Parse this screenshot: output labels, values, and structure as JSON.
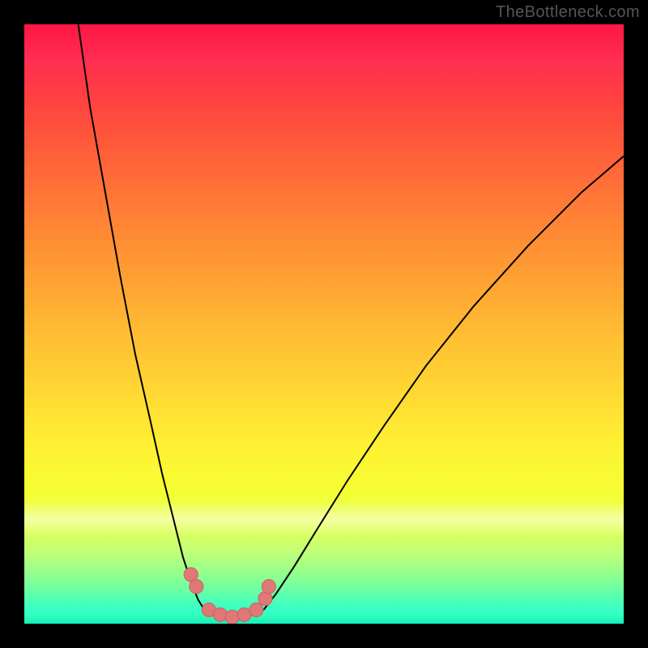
{
  "watermark": "TheBottleneck.com",
  "colors": {
    "curve_stroke": "#000000",
    "marker_fill": "#e07878",
    "marker_stroke": "#d06060"
  },
  "chart_data": {
    "type": "line",
    "title": "",
    "xlabel": "",
    "ylabel": "",
    "xlim": [
      0,
      100
    ],
    "ylim": [
      0,
      100
    ],
    "note": "Axes have no tick labels; values are approximate positions in percent of plot area (0,0 = top-left).",
    "series": [
      {
        "name": "left-arm",
        "x": [
          9.0,
          11.0,
          13.5,
          16.0,
          18.5,
          21.0,
          23.0,
          25.0,
          26.5,
          28.0,
          29.0,
          30.0
        ],
        "y": [
          0.0,
          14.0,
          28.0,
          42.0,
          55.0,
          66.0,
          75.0,
          83.0,
          89.0,
          93.5,
          96.0,
          97.6
        ]
      },
      {
        "name": "valley-floor",
        "x": [
          30.0,
          31.5,
          33.0,
          35.0,
          37.0,
          38.5,
          40.0
        ],
        "y": [
          97.6,
          98.4,
          98.8,
          99.0,
          98.8,
          98.4,
          97.6
        ]
      },
      {
        "name": "right-arm",
        "x": [
          40.0,
          42.0,
          45.0,
          49.0,
          54.0,
          60.0,
          67.0,
          75.0,
          84.0,
          93.0,
          100.0
        ],
        "y": [
          97.6,
          95.0,
          90.5,
          84.0,
          76.0,
          67.0,
          57.0,
          47.0,
          37.0,
          28.0,
          22.0
        ]
      }
    ],
    "markers": {
      "name": "highlight-dots",
      "x": [
        27.8,
        28.7,
        30.8,
        32.7,
        34.7,
        36.7,
        38.7,
        40.2,
        40.8
      ],
      "y": [
        91.8,
        93.8,
        97.7,
        98.5,
        98.9,
        98.5,
        97.7,
        95.8,
        93.8
      ]
    }
  }
}
